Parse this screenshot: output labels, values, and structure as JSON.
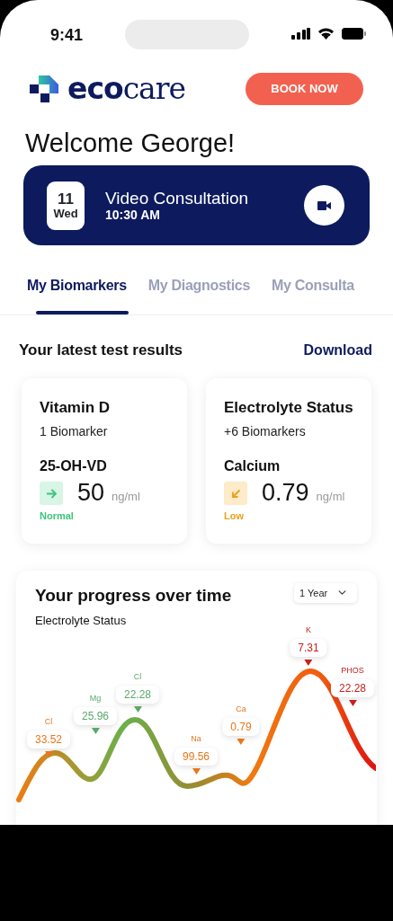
{
  "status_bar": {
    "time": "9:41"
  },
  "header": {
    "logo": "**eco**care",
    "button": "BOOK NOW"
  },
  "greeting": "Welcome George!",
  "appointment": {
    "day": "11",
    "weekday": "Wed",
    "title": "Video Consultation",
    "time": "10:30 AM"
  },
  "tabs": [
    {
      "label": "My Biomarkers",
      "selected": true
    },
    {
      "label": "My Diagnostics",
      "selected": false
    },
    {
      "label": "My Consulta",
      "selected": false
    }
  ],
  "results": {
    "title": "Your latest test results",
    "action": "Download",
    "cards": [
      {
        "title": "Vitamin D",
        "subtitle": "1 Biomarker",
        "marker": "25-OH-VD",
        "value": "50",
        "unit": "ng/ml",
        "status": "Normal",
        "kind": "normal"
      },
      {
        "title": "Electrolyte Status",
        "subtitle": "+6 Biomarkers",
        "marker": "Calcium",
        "value": "0.79",
        "unit": "ng/ml",
        "status": "Low",
        "kind": "low"
      }
    ]
  },
  "progress": {
    "title": "Your progress over time",
    "subtitle": "Electrolyte Status",
    "period": "1 Year",
    "points": [
      {
        "name": "Cl",
        "value": "33.52",
        "color": "#e8761c"
      },
      {
        "name": "Mg",
        "value": "25.96",
        "color": "#5aa86a"
      },
      {
        "name": "Cl",
        "value": "22.28",
        "color": "#5aa86a"
      },
      {
        "name": "Na",
        "value": "99.56",
        "color": "#e8761c"
      },
      {
        "name": "Ca",
        "value": "0.79",
        "color": "#e8761c"
      },
      {
        "name": "K",
        "value": "7.31",
        "color": "#c8201c"
      },
      {
        "name": "PHOS",
        "value": "22.28",
        "color": "#c8201c"
      }
    ]
  }
}
